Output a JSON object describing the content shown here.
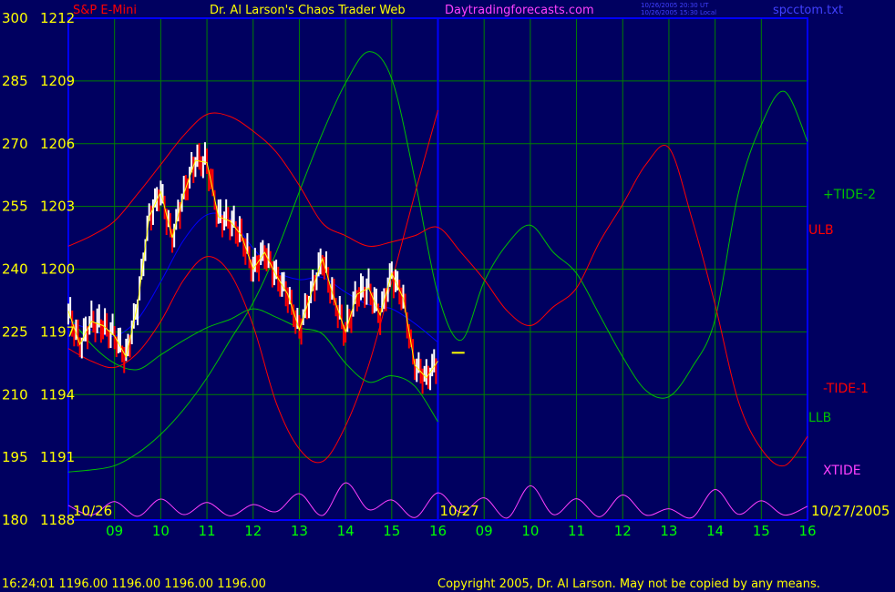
{
  "header": {
    "instrument": "S&P E-Mini",
    "site_title": "Dr. Al Larson's Chaos Trader Web",
    "site_url": "Daytradingforecasts.com",
    "timestamp_ut": "10/26/2005 20:30 UT",
    "timestamp_local": "10/26/2005 15:30 Local",
    "file": "spcctom.txt"
  },
  "footer": {
    "quote": "16:24:01  1196.00 1196.00 1196.00 1196.00",
    "copyright": "Copyright 2005, Dr. Al Larson. May not be copied by any means."
  },
  "colors": {
    "background": "#000060",
    "grid": "#008000",
    "frame": "#0000ff",
    "left_labels": "#ffff00",
    "time_labels": "#00ff00",
    "red_series": "#ff0000",
    "green_series": "#00c000",
    "magenta_series": "#ff40ff",
    "blue_series": "#0000ff",
    "yellow_series": "#ffff00",
    "white_bars": "#ffffff"
  },
  "chart_data": {
    "type": "line",
    "title": "S&P E-Mini",
    "left_axis": {
      "secondary": [
        "300",
        "285",
        "270",
        "255",
        "240",
        "225",
        "210",
        "195",
        "180"
      ],
      "price": [
        1212,
        1209,
        1206,
        1203,
        1200,
        1197,
        1194,
        1191,
        1188
      ],
      "ylim": [
        1188,
        1212
      ]
    },
    "x_axis": {
      "date_labels": [
        "10/26",
        "10/27",
        "10/27/2005"
      ],
      "hour_labels": [
        "09",
        "10",
        "11",
        "12",
        "13",
        "14",
        "15",
        "16",
        "09",
        "10",
        "11",
        "12",
        "13",
        "14",
        "15",
        "16"
      ],
      "xlim": [
        0,
        16
      ]
    },
    "series": [
      {
        "name": "+TIDE-2",
        "color": "#00c000",
        "x": [
          0,
          0.5,
          1,
          1.5,
          2,
          2.5,
          3,
          3.5,
          4,
          4.5,
          5,
          5.5,
          6,
          6.5,
          7,
          7.5,
          8,
          8.5,
          9,
          9.5,
          10,
          10.5,
          11,
          11.5,
          12,
          12.5,
          13,
          13.5,
          14,
          14.5,
          15,
          15.5,
          16
        ],
        "y": [
          1190.3,
          1190.4,
          1190.6,
          1191.2,
          1192.1,
          1193.3,
          1194.8,
          1196.6,
          1198.4,
          1200.8,
          1203.7,
          1206.5,
          1208.9,
          1210.4,
          1209.1,
          1204.3,
          1198.8,
          1196.6,
          1199.4,
          1201.2,
          1202.1,
          1200.8,
          1199.8,
          1197.8,
          1195.8,
          1194.2,
          1193.9,
          1195.3,
          1197.6,
          1203.6,
          1206.9,
          1208.5,
          1206.1
        ]
      },
      {
        "name": "ULB",
        "color": "#ff0000",
        "x": [
          0,
          0.5,
          1,
          1.5,
          2,
          2.5,
          3,
          3.5,
          4,
          4.5,
          5,
          5.5,
          6,
          6.5,
          7,
          7.5,
          8,
          8.5,
          9,
          9.5,
          10,
          10.5,
          11,
          11.5,
          12,
          12.5,
          13,
          13.5,
          14,
          14.5,
          15,
          15.5,
          16
        ],
        "y": [
          1201.1,
          1201.6,
          1202.3,
          1203.6,
          1205.0,
          1206.4,
          1207.4,
          1207.3,
          1206.6,
          1205.6,
          1204.0,
          1202.2,
          1201.6,
          1201.1,
          1201.3,
          1201.6,
          1202.0,
          1200.8,
          1199.5,
          1198.0,
          1197.3,
          1198.2,
          1199.1,
          1201.3,
          1203.1,
          1205.0,
          1205.8,
          1202.4,
          1198.3,
          1193.7,
          1191.4,
          1190.6,
          1192.0
        ]
      },
      {
        "name": "-TIDE-1",
        "color": "#ff0000",
        "x": [
          0,
          0.5,
          1,
          1.5,
          2,
          2.5,
          3,
          3.5,
          4,
          4.5,
          5,
          5.5,
          6,
          6.5,
          7,
          7.5,
          8
        ],
        "y": [
          1196.2,
          1195.6,
          1195.3,
          1196.0,
          1197.5,
          1199.5,
          1200.6,
          1199.8,
          1197.3,
          1193.6,
          1191.4,
          1190.8,
          1192.5,
          1195.4,
          1199.4,
          1203.6,
          1207.6
        ]
      },
      {
        "name": "LLB",
        "color": "#00c000",
        "x": [
          0,
          0.5,
          1,
          1.5,
          2,
          2.5,
          3,
          3.5,
          4,
          4.5,
          5,
          5.5,
          6,
          6.5,
          7,
          7.5,
          8
        ],
        "y": [
          1197.8,
          1196.4,
          1195.5,
          1195.2,
          1195.9,
          1196.6,
          1197.2,
          1197.6,
          1198.1,
          1197.7,
          1197.2,
          1196.9,
          1195.5,
          1194.6,
          1194.9,
          1194.4,
          1192.7
        ]
      },
      {
        "name": "XTIDE",
        "color": "#ff40ff",
        "x": [
          0,
          0.5,
          1,
          1.5,
          2,
          2.5,
          3,
          3.5,
          4,
          4.5,
          5,
          5.5,
          6,
          6.5,
          7,
          7.5,
          8,
          8.5,
          9,
          9.5,
          10,
          10.5,
          11,
          11.5,
          12,
          12.5,
          13,
          13.5,
          14,
          14.5,
          15,
          15.5,
          16
        ],
        "y": [
          183.5,
          181.2,
          184.4,
          180.9,
          185.0,
          181.3,
          184.2,
          181.0,
          183.7,
          182.0,
          186.3,
          181.1,
          188.9,
          182.5,
          184.8,
          180.6,
          186.5,
          181.8,
          185.3,
          180.5,
          188.2,
          181.3,
          185.1,
          180.8,
          186.0,
          181.2,
          182.7,
          180.6,
          187.3,
          181.4,
          184.6,
          181.2,
          183.3
        ]
      },
      {
        "name": "",
        "color": "#0000ff",
        "x": [
          0,
          0.5,
          1,
          1.5,
          2,
          2.5,
          3,
          3.5,
          4,
          4.5,
          5,
          5.5,
          6,
          6.5,
          7,
          7.5,
          8
        ],
        "y": [
          1197.5,
          1197.1,
          1196.8,
          1197.6,
          1199.4,
          1201.4,
          1202.6,
          1202.4,
          1201.0,
          1199.9,
          1199.5,
          1199.6,
          1198.9,
          1198.3,
          1198.1,
          1197.4,
          1196.5
        ]
      }
    ],
    "price_bars": {
      "x": [
        0,
        0.25,
        0.5,
        0.75,
        1,
        1.25,
        1.5,
        1.75,
        2,
        2.25,
        2.5,
        2.75,
        3,
        3.25,
        3.5,
        3.75,
        4,
        4.25,
        4.5,
        4.75,
        5,
        5.25,
        5.5,
        5.75,
        6,
        6.25,
        6.5,
        6.75,
        7,
        7.25,
        7.5,
        7.75,
        8
      ],
      "y": [
        1198.0,
        1196.4,
        1197.5,
        1197.3,
        1196.8,
        1195.8,
        1198.3,
        1202.5,
        1203.7,
        1201.5,
        1203.6,
        1205.2,
        1205.1,
        1202.5,
        1202.3,
        1201.6,
        1200.0,
        1200.8,
        1199.7,
        1198.8,
        1197.1,
        1198.8,
        1200.5,
        1198.6,
        1197.0,
        1198.8,
        1199.1,
        1197.8,
        1199.8,
        1198.6,
        1195.4,
        1194.8,
        1195.6
      ]
    },
    "marker": {
      "x": 8.3,
      "y": 1196.0,
      "color": "#ffff00"
    }
  }
}
